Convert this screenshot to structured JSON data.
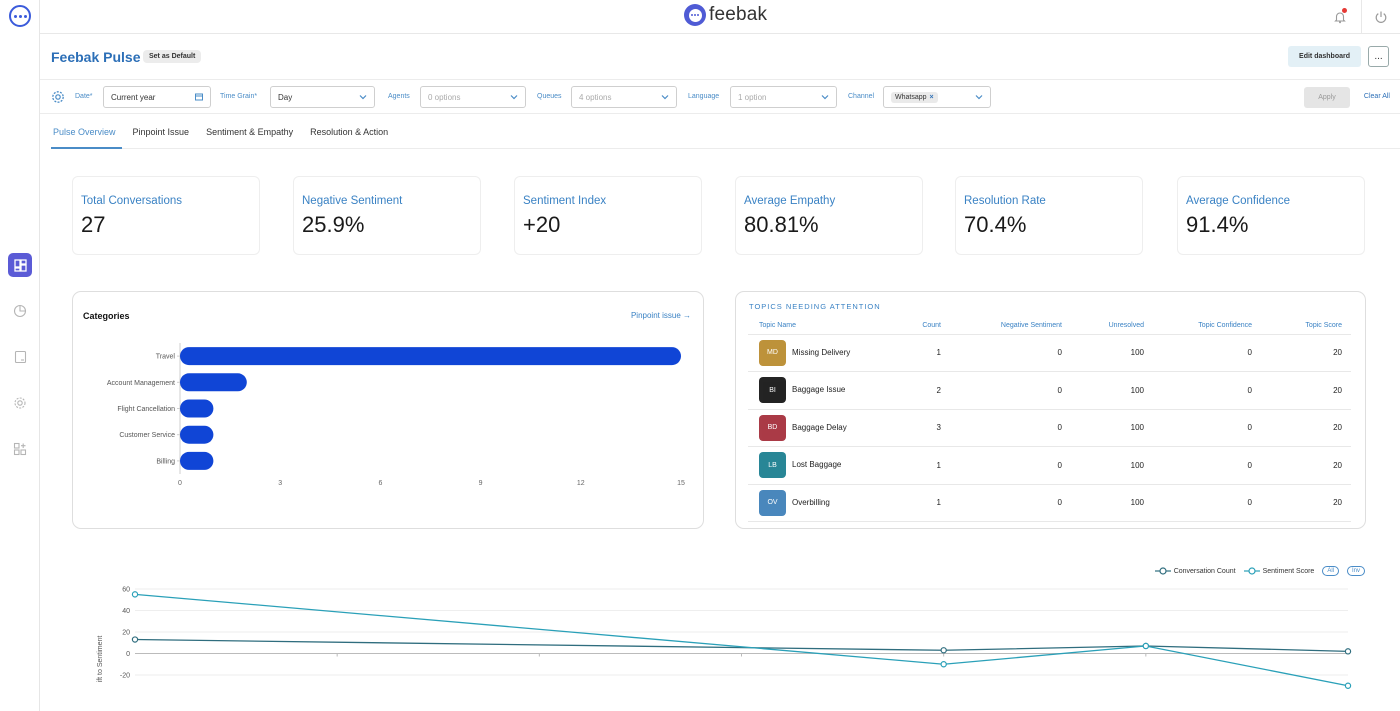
{
  "app": {
    "brand": "feebak"
  },
  "page": {
    "title": "Feebak Pulse",
    "set_default": "Set as Default",
    "edit_dashboard": "Edit dashboard",
    "more": "..."
  },
  "filters": {
    "date_label": "Date*",
    "date_value": "Current year",
    "time_grain_label": "Time Grain*",
    "time_grain_value": "Day",
    "agents_label": "Agents",
    "agents_placeholder": "0 options",
    "queues_label": "Queues",
    "queues_placeholder": "4 options",
    "language_label": "Language",
    "language_placeholder": "1 option",
    "channel_label": "Channel",
    "channel_chip": "Whatsapp",
    "apply": "Apply",
    "clear_all": "Clear All"
  },
  "tabs": [
    "Pulse Overview",
    "Pinpoint Issue",
    "Sentiment & Empathy",
    "Resolution & Action"
  ],
  "kpis": [
    {
      "label": "Total Conversations",
      "value": "27"
    },
    {
      "label": "Negative Sentiment",
      "value": "25.9%"
    },
    {
      "label": "Sentiment Index",
      "value": "+20"
    },
    {
      "label": "Average Empathy",
      "value": "80.81%"
    },
    {
      "label": "Resolution Rate",
      "value": "70.4%"
    },
    {
      "label": "Average Confidence",
      "value": "91.4%"
    }
  ],
  "categories_panel": {
    "title": "Categories",
    "link": "Pinpoint issue →"
  },
  "topics": {
    "title": "TOPICS NEEDING ATTENTION",
    "headers": [
      "Topic Name",
      "Count",
      "Negative Sentiment",
      "Unresolved",
      "Topic Confidence",
      "Topic Score"
    ],
    "rows": [
      {
        "initials": "MD",
        "color": "#b8892a",
        "name": "Missing Delivery",
        "count": "1",
        "neg": "0",
        "unresolved": "100",
        "conf": "0",
        "score": "20"
      },
      {
        "initials": "BI",
        "color": "#111111",
        "name": "Baggage Issue",
        "count": "2",
        "neg": "0",
        "unresolved": "100",
        "conf": "0",
        "score": "20"
      },
      {
        "initials": "BD",
        "color": "#a32a37",
        "name": "Baggage Delay",
        "count": "3",
        "neg": "0",
        "unresolved": "100",
        "conf": "0",
        "score": "20"
      },
      {
        "initials": "LB",
        "color": "#167c8e",
        "name": "Lost Baggage",
        "count": "1",
        "neg": "0",
        "unresolved": "100",
        "conf": "0",
        "score": "20"
      },
      {
        "initials": "OV",
        "color": "#3a7db7",
        "name": "Overbilling",
        "count": "1",
        "neg": "0",
        "unresolved": "100",
        "conf": "0",
        "score": "20"
      }
    ]
  },
  "legend": {
    "series1": "Conversation Count",
    "series2": "Sentiment Score",
    "pill_all": "All",
    "pill_inv": "Inv"
  },
  "colors": {
    "accent": "#3a82c4",
    "bar": "#1045d6",
    "line_count": "#2f6d7e",
    "line_sentiment": "#2aa0b8"
  },
  "chart_data": [
    {
      "type": "bar",
      "orientation": "horizontal",
      "title": "Categories",
      "categories": [
        "Travel",
        "Account Management",
        "Flight Cancellation",
        "Customer Service",
        "Billing"
      ],
      "values": [
        15,
        2,
        1,
        1,
        1
      ],
      "xticks": [
        "0",
        "3",
        "6",
        "9",
        "12",
        "15"
      ],
      "xlim": [
        0,
        15
      ]
    },
    {
      "type": "line",
      "ylabel": "ift to Sentiment",
      "yticks": [
        "60",
        "40",
        "20",
        "0",
        "-20"
      ],
      "ylim": [
        -20,
        60
      ],
      "x_points": 7,
      "series": [
        {
          "name": "Conversation Count",
          "values": [
            13,
            null,
            null,
            null,
            3,
            7,
            2
          ]
        },
        {
          "name": "Sentiment Score",
          "values": [
            55,
            null,
            null,
            null,
            -10,
            7,
            -30
          ]
        }
      ]
    }
  ]
}
